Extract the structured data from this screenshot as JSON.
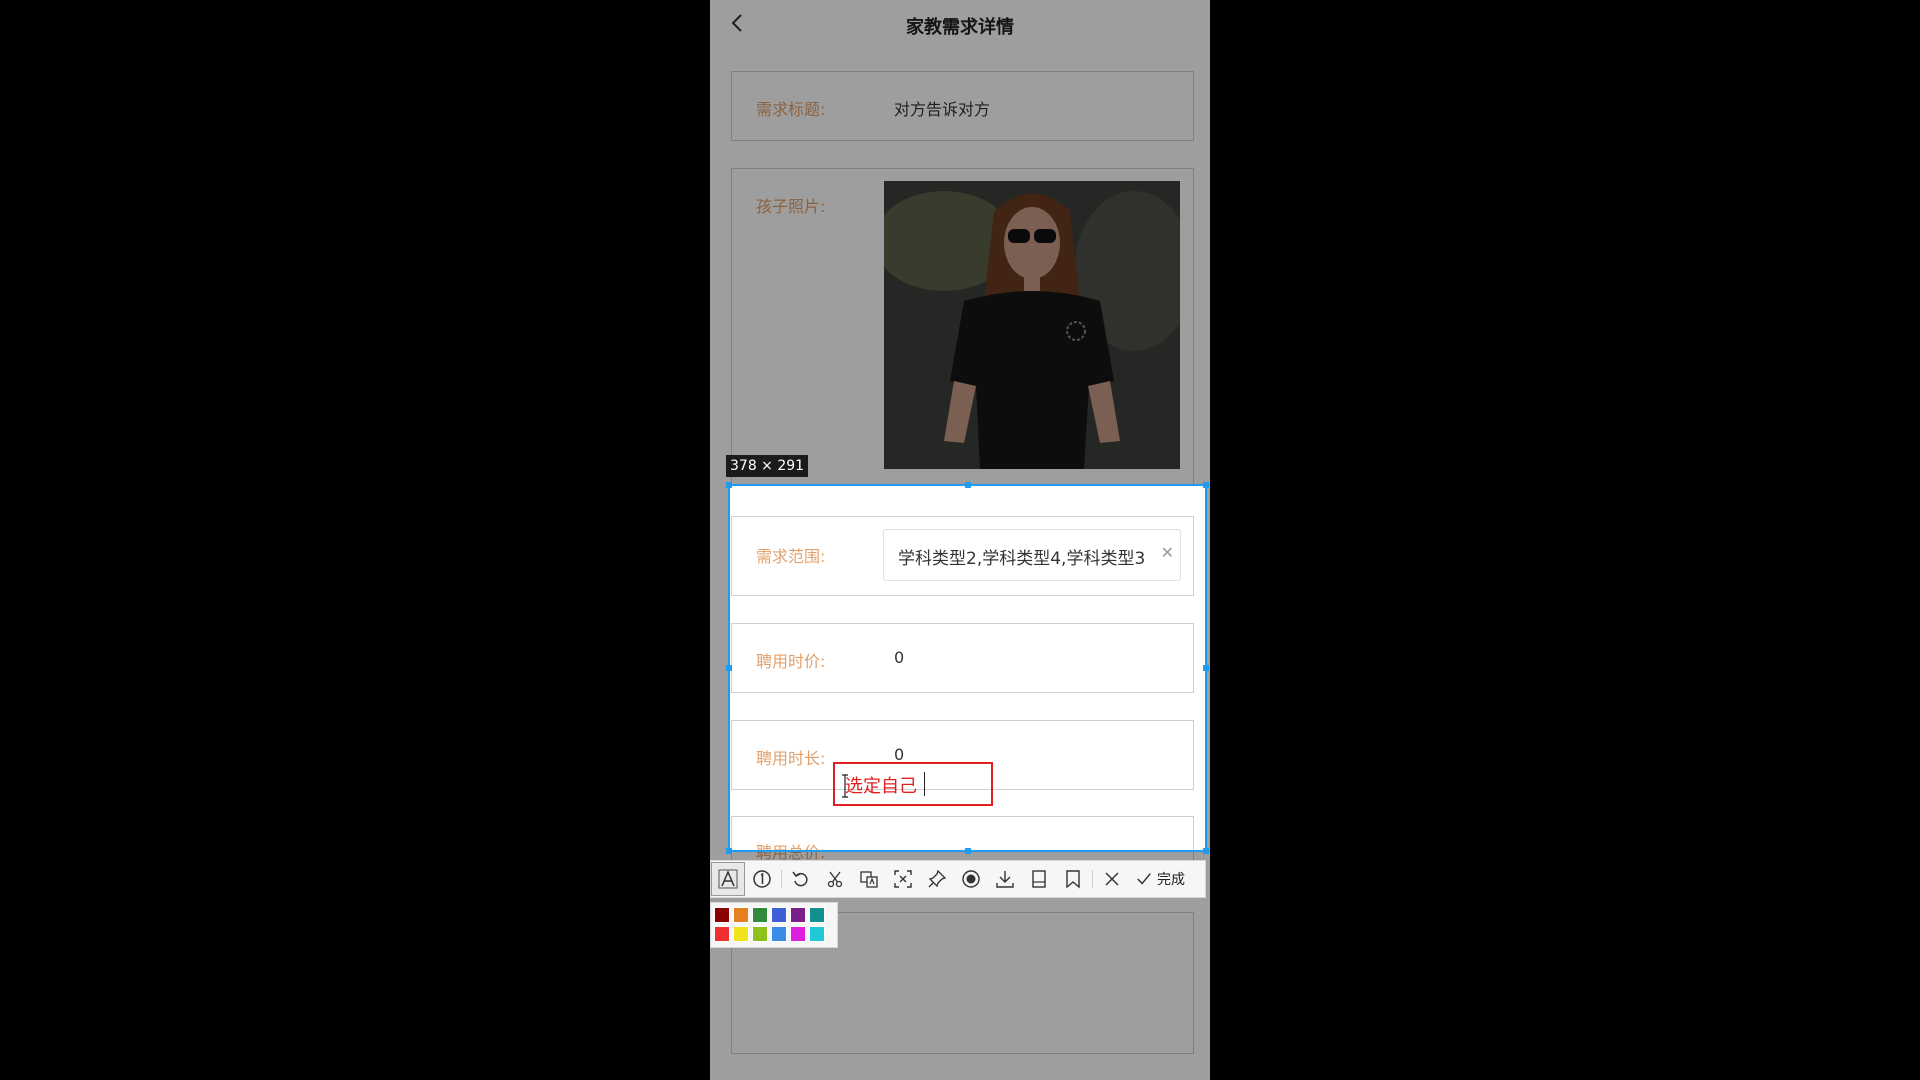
{
  "nav": {
    "title": "家教需求详情"
  },
  "fields": {
    "title_label": "需求标题:",
    "title_value": "对方告诉对方",
    "photo_label": "孩子照片:",
    "scope_label": "需求范围:",
    "scope_value": "学科类型2,学科类型4,学科类型3",
    "hourly_label": "聘用时价:",
    "hourly_value": "0",
    "duration_label": "聘用时长:",
    "duration_value": "0",
    "total_label": "聘用总价:"
  },
  "screenshot_tool": {
    "size_label": "378 × 291",
    "annotation_text": "选定自己",
    "done_label": "完成",
    "tools": [
      "text-icon",
      "number-icon",
      "undo-icon",
      "scissors-icon",
      "translate-icon",
      "ocr-icon",
      "pin-icon",
      "record-icon",
      "download-icon",
      "save-icon",
      "bookmark-icon",
      "close-icon"
    ],
    "palette": [
      "#8b0000",
      "#e6801f",
      "#2e8b3a",
      "#3f5fd6",
      "#7a1f8a",
      "#12908e",
      "#f03030",
      "#f2e21a",
      "#8cc21a",
      "#3a8ce6",
      "#e020e0",
      "#20c8d8"
    ]
  },
  "colors": {
    "label": "#e3a06a",
    "selection": "#1e9bf0",
    "annotation": "#e02020"
  }
}
